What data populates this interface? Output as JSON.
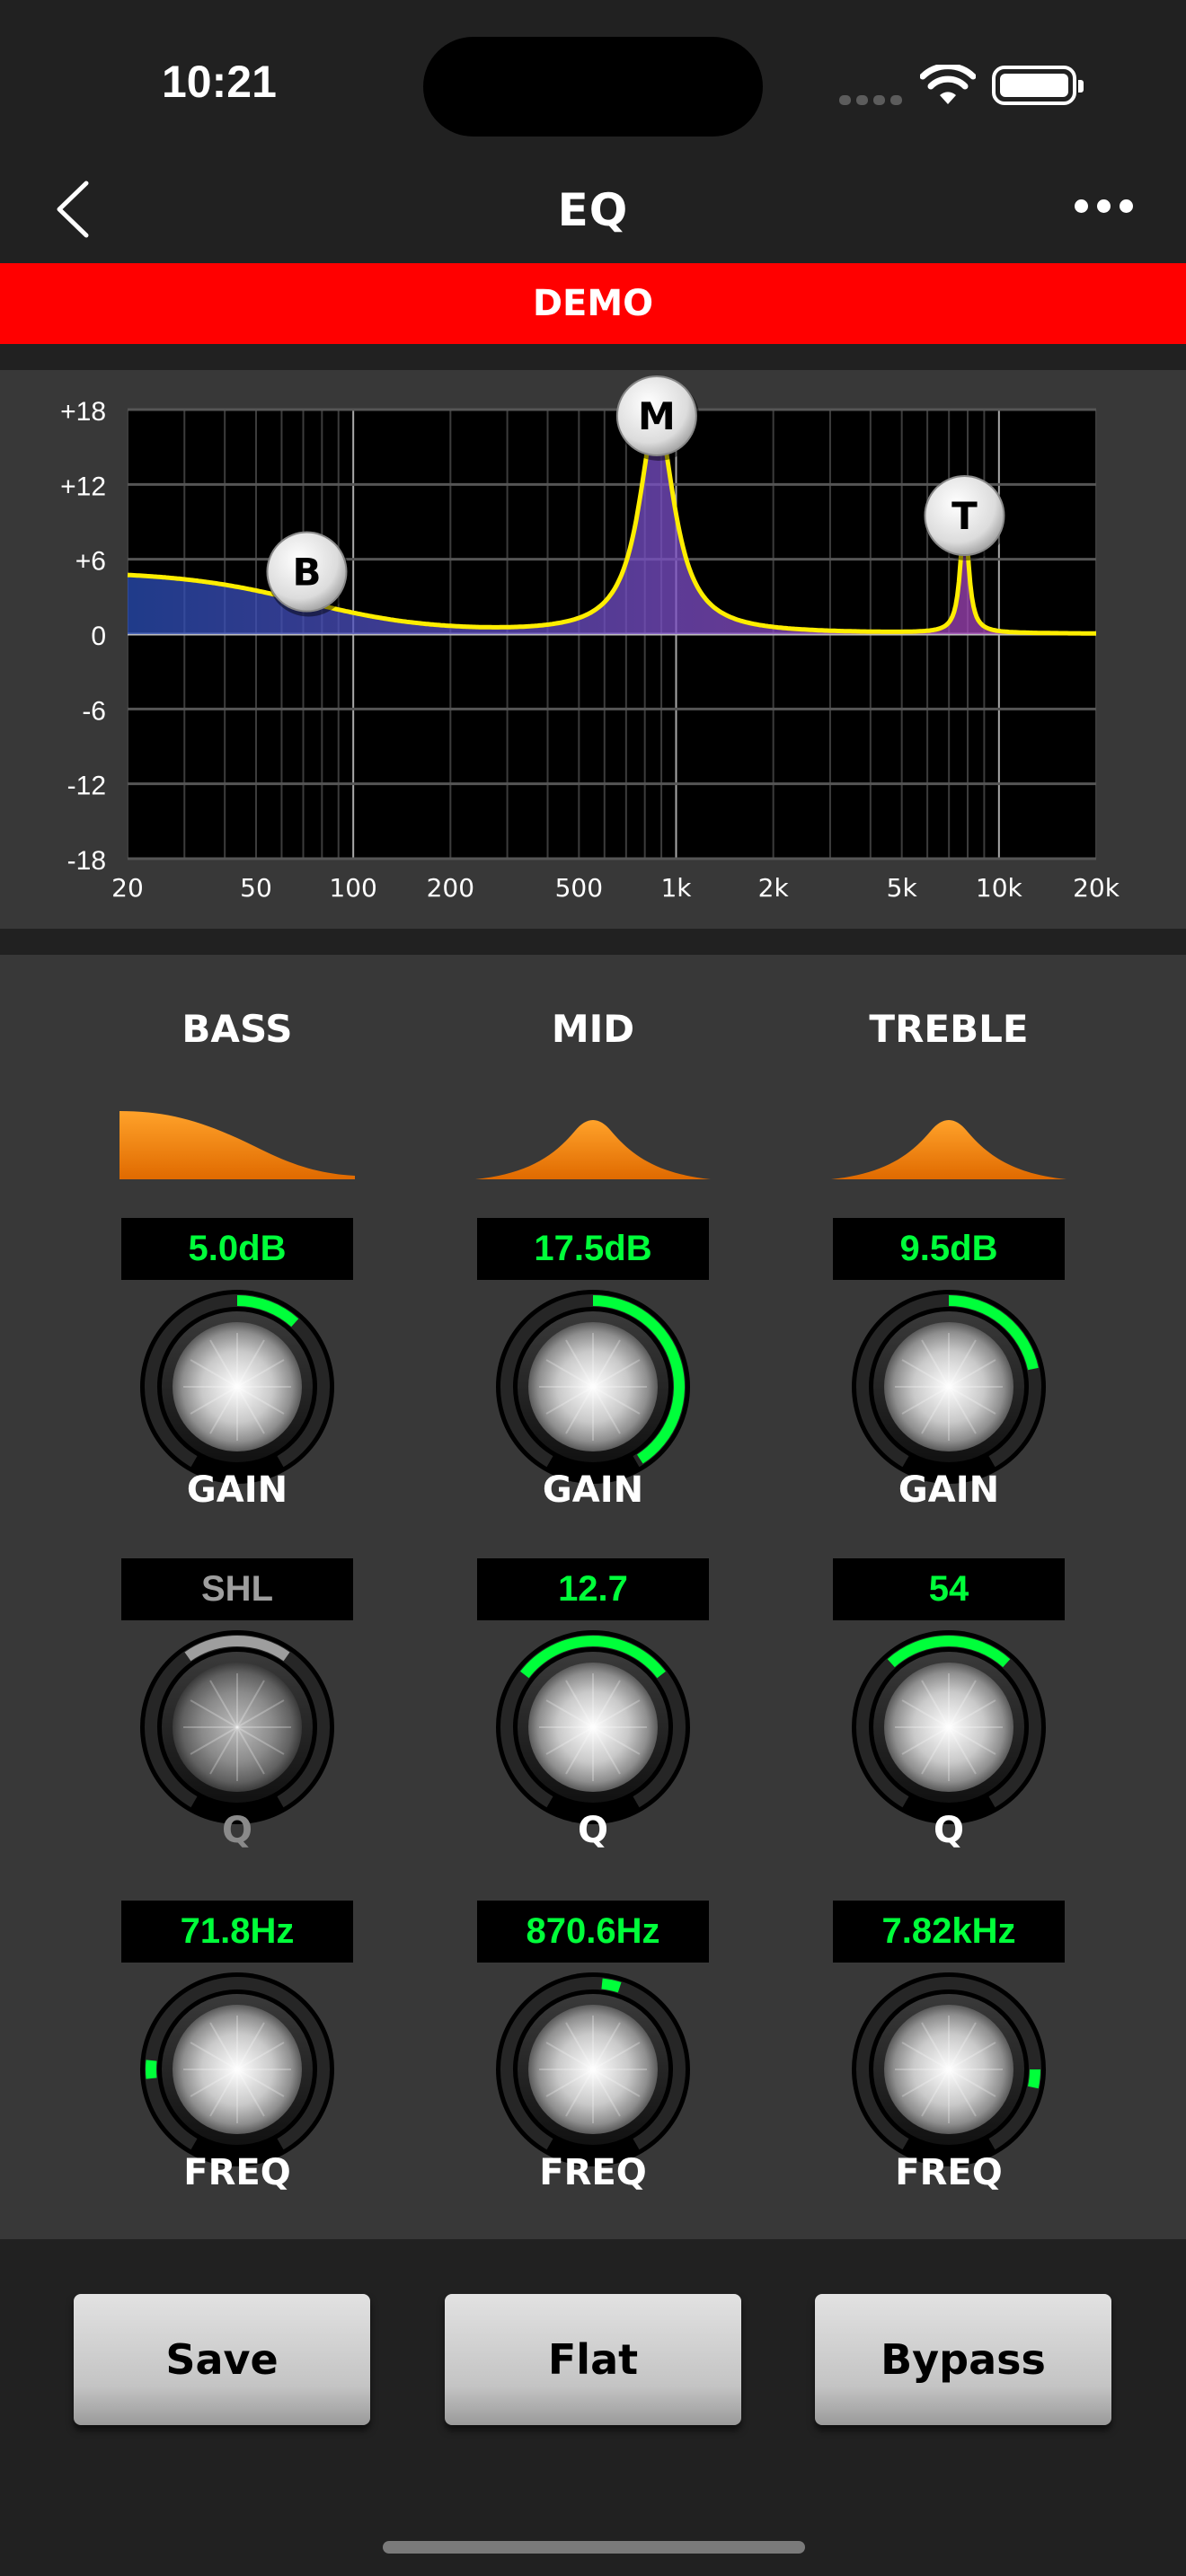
{
  "status_bar": {
    "time": "10:21"
  },
  "nav": {
    "title": "EQ"
  },
  "banner": {
    "text": "DEMO"
  },
  "graph": {
    "y_ticks": [
      "+18",
      "+12",
      "+6",
      "0",
      "-6",
      "-12",
      "-18"
    ],
    "x_ticks": [
      "20",
      "50",
      "100",
      "200",
      "500",
      "1k",
      "2k",
      "5k",
      "10k",
      "20k"
    ],
    "nodes": {
      "bass": "B",
      "mid": "M",
      "treble": "T"
    },
    "curve_color": "#ffee00"
  },
  "bands": [
    {
      "title": "BASS",
      "gain": {
        "value": "5.0dB",
        "label": "GAIN",
        "level": 0.64
      },
      "q": {
        "value": "SHL",
        "label": "Q",
        "level": 0.5,
        "enabled": false
      },
      "freq": {
        "value": "71.8Hz",
        "label": "FREQ",
        "level": 0.2
      }
    },
    {
      "title": "MID",
      "gain": {
        "value": "17.5dB",
        "label": "GAIN",
        "level": 0.99
      },
      "q": {
        "value": "12.7",
        "label": "Q",
        "level": 0.75
      },
      "freq": {
        "value": "870.6Hz",
        "label": "FREQ",
        "level": 0.54
      }
    },
    {
      "title": "TREBLE",
      "gain": {
        "value": "9.5dB",
        "label": "GAIN",
        "level": 0.76
      },
      "q": {
        "value": "54",
        "label": "Q",
        "level": 0.6
      },
      "freq": {
        "value": "7.82kHz",
        "label": "FREQ",
        "level": 0.82
      }
    }
  ],
  "buttons": {
    "save": "Save",
    "flat": "Flat",
    "bypass": "Bypass"
  },
  "colors": {
    "accent": "#00ff3a",
    "banner": "#ff0000",
    "shape": "#ff8c00"
  }
}
